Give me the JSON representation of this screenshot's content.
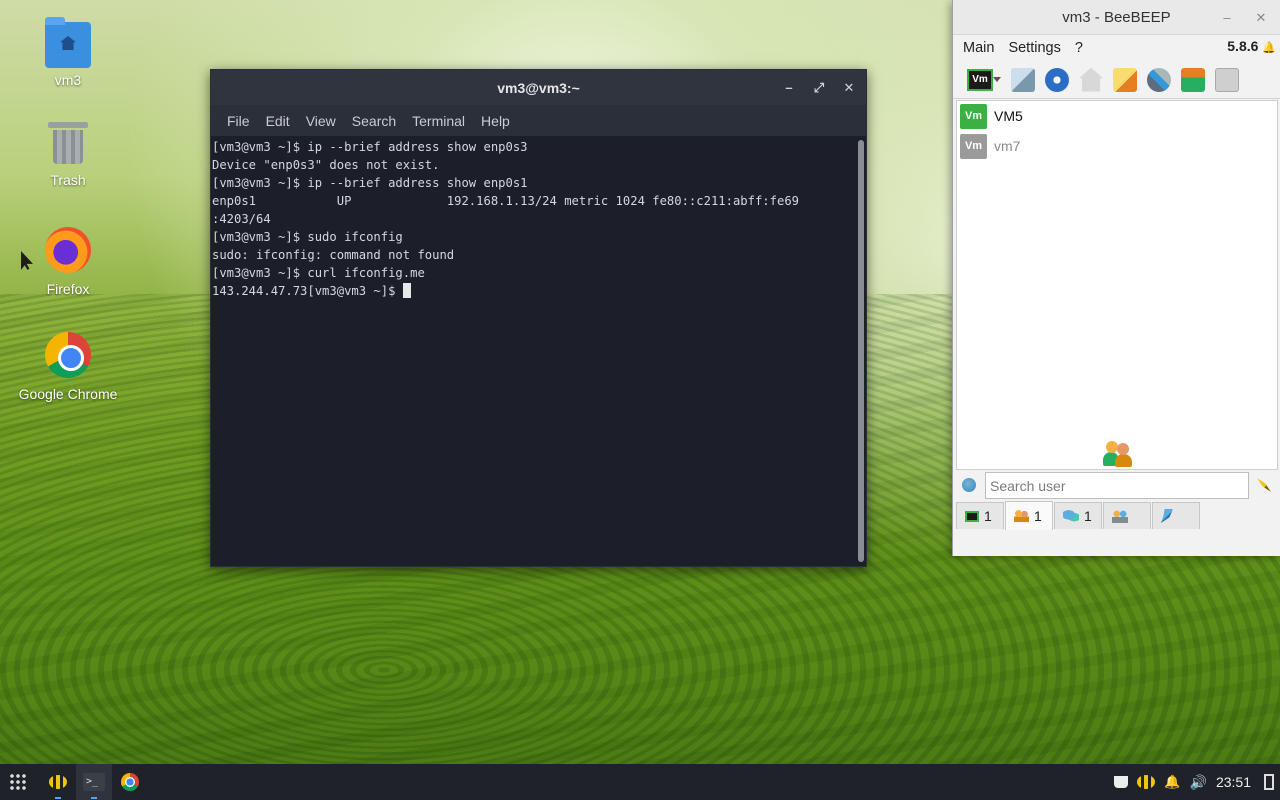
{
  "desktop": {
    "icons": [
      {
        "label": "vm3",
        "icon": "home-folder-icon"
      },
      {
        "label": "Trash",
        "icon": "trash-icon"
      },
      {
        "label": "Firefox",
        "icon": "firefox-icon"
      },
      {
        "label": "Google Chrome",
        "icon": "chrome-icon"
      }
    ]
  },
  "terminal": {
    "title": "vm3@vm3:~",
    "menu": [
      "File",
      "Edit",
      "View",
      "Search",
      "Terminal",
      "Help"
    ],
    "lines": [
      "[vm3@vm3 ~]$ ip --brief address show enp0s3",
      "Device \"enp0s3\" does not exist.",
      "[vm3@vm3 ~]$ ip --brief address show enp0s1",
      "enp0s1           UP             192.168.1.13/24 metric 1024 fe80::c211:abff:fe69",
      ":4203/64",
      "[vm3@vm3 ~]$ sudo ifconfig",
      "sudo: ifconfig: command not found",
      "[vm3@vm3 ~]$ curl ifconfig.me",
      "143.244.47.73[vm3@vm3 ~]$ "
    ],
    "controls": {
      "minimize": "–",
      "maximize": "⤢",
      "close": "✕"
    }
  },
  "beebeep": {
    "title": "vm3 - BeeBEEP",
    "menu": [
      "Main",
      "Settings",
      "?"
    ],
    "version": "5.8.6",
    "version_icon": "bell-icon",
    "controls": {
      "minimize": "–",
      "close": "✕"
    },
    "users": [
      {
        "badge": "Vm",
        "name": "VM5",
        "online": true,
        "badge_color": "#3cb043"
      },
      {
        "badge": "Vm",
        "name": "vm7",
        "online": false,
        "badge_color": "#9a9a9a"
      }
    ],
    "search": {
      "placeholder": "Search user",
      "value": ""
    },
    "tabs": [
      {
        "icon": "computer-icon",
        "count": "1"
      },
      {
        "icon": "users-icon",
        "count": "1"
      },
      {
        "icon": "chat-icon",
        "count": "1"
      },
      {
        "icon": "group-icon",
        "count": ""
      },
      {
        "icon": "pin-icon",
        "count": ""
      }
    ]
  },
  "taskbar": {
    "clock": "23:51",
    "tray_icons": [
      "coffee-icon",
      "bee-icon",
      "bell-icon",
      "volume-icon"
    ]
  },
  "colors": {
    "terminal_bg": "#1c1f29",
    "titlebar": "#2f343f",
    "taskbar": "#1f2228",
    "online_green": "#3cb043"
  }
}
